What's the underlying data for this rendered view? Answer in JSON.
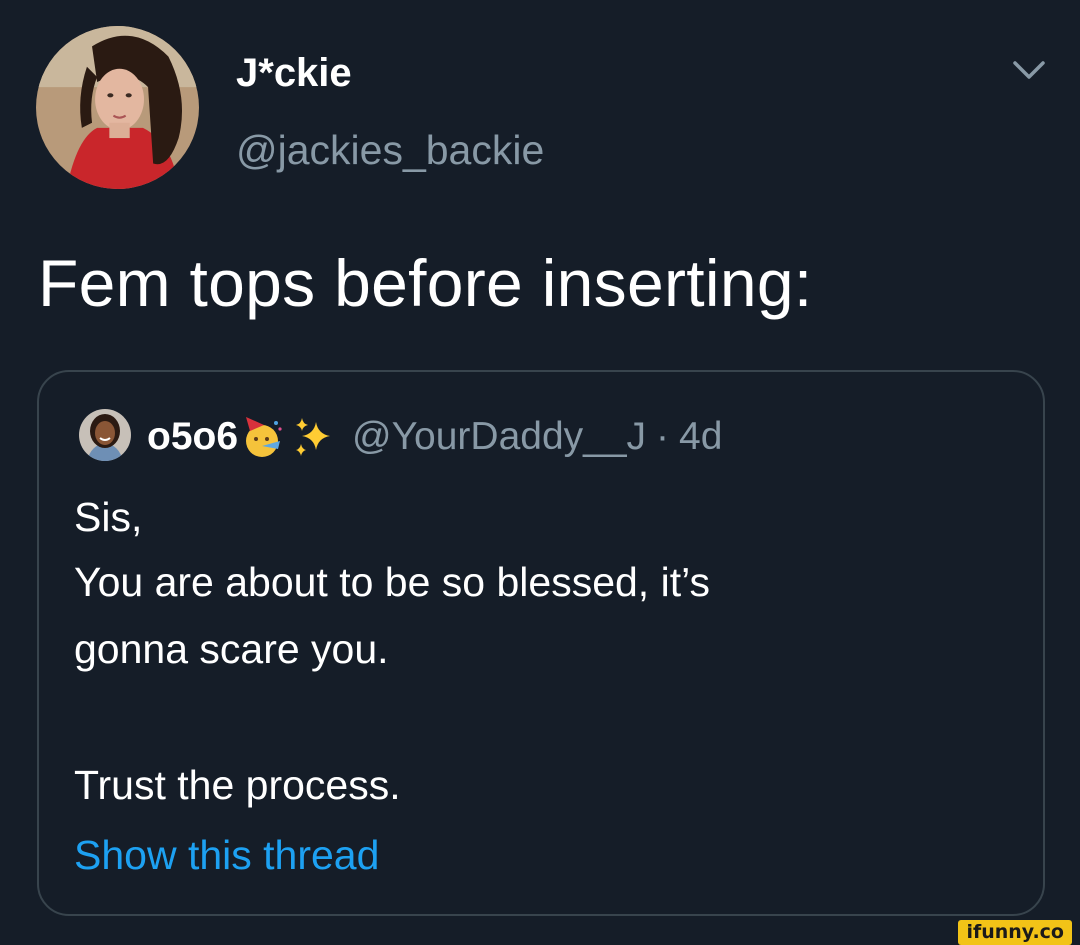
{
  "tweet": {
    "author": {
      "display_name": "J*ckie",
      "handle": "@jackies_backie"
    },
    "text": "Fem tops before inserting:",
    "menu_icon": "chevron-down-icon"
  },
  "quoted_tweet": {
    "author": {
      "display_name": "o5o6",
      "handle": "@YourDaddy__J",
      "emojis": [
        "partying-face",
        "sparkles"
      ]
    },
    "separator": "·",
    "time": "4d",
    "lines": [
      "Sis,",
      "You are about to be so blessed, it’s",
      "gonna scare you.",
      "Trust the process."
    ],
    "show_thread": "Show this thread"
  },
  "watermark": "ifunny.co",
  "colors": {
    "background": "#151d28",
    "text": "#ffffff",
    "secondary": "#8899a6",
    "link": "#1da1f2",
    "border": "#38444d",
    "watermark": "#f2c317"
  }
}
